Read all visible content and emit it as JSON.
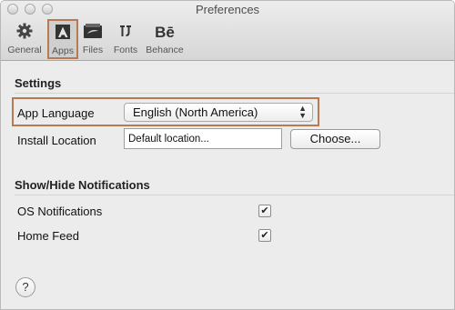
{
  "window": {
    "title": "Preferences"
  },
  "toolbar": {
    "items": [
      {
        "label": "General",
        "icon": "gear-icon"
      },
      {
        "label": "Apps",
        "icon": "adobe-icon",
        "selected": true
      },
      {
        "label": "Files",
        "icon": "folder-icon"
      },
      {
        "label": "Fonts",
        "icon": "fonts-icon"
      },
      {
        "label": "Behance",
        "icon": "behance-icon"
      }
    ]
  },
  "settings": {
    "heading": "Settings",
    "app_language": {
      "label": "App Language",
      "value": "English (North America)"
    },
    "install_location": {
      "label": "Install Location",
      "value": "Default location...",
      "button": "Choose..."
    }
  },
  "notifications": {
    "heading": "Show/Hide Notifications",
    "items": [
      {
        "label": "OS Notifications",
        "checked": true
      },
      {
        "label": "Home Feed",
        "checked": true
      }
    ]
  },
  "help": {
    "label": "?"
  },
  "colors": {
    "highlight": "#b77a54"
  }
}
